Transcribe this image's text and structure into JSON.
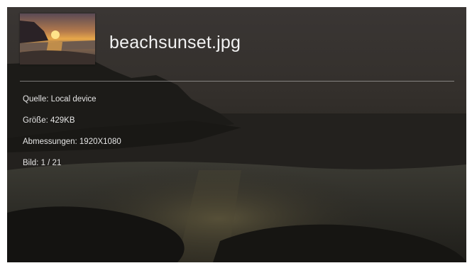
{
  "file": {
    "name": "beachsunset.jpg"
  },
  "details": {
    "source": "Quelle: Local device",
    "size": "Größe: 429KB",
    "dimensions": "Abmessungen: 1920X1080",
    "image_index": "Bild: 1 / 21"
  },
  "colors": {
    "text": "#f2f2f2",
    "divider": "#c8c8c8",
    "frame_border": "#000000"
  }
}
